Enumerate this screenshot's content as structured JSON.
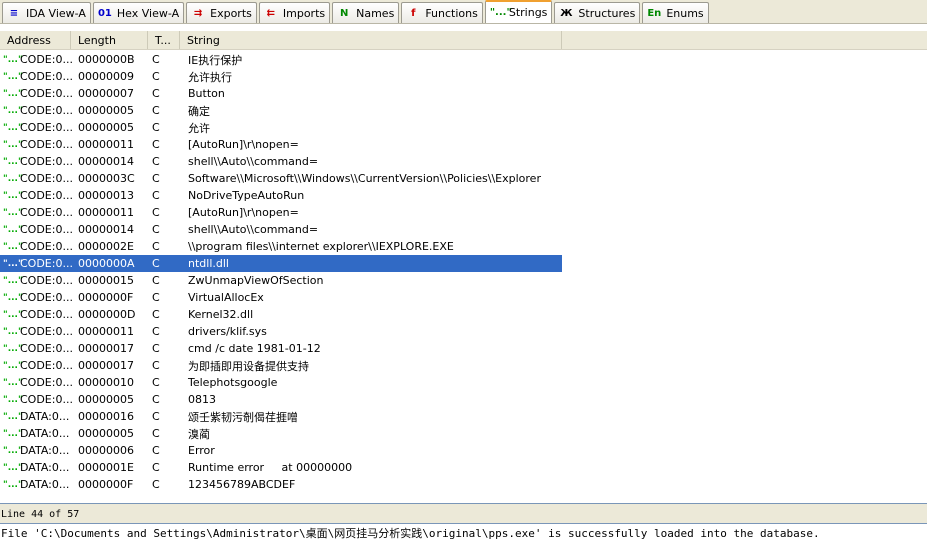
{
  "tabs": [
    {
      "label": "IDA View-A",
      "icon": "disassembly-icon",
      "glyph": "≡",
      "color": "#00c"
    },
    {
      "label": "Hex View-A",
      "icon": "hex-icon",
      "glyph": "01",
      "color": "#00c"
    },
    {
      "label": "Exports",
      "icon": "exports-icon",
      "glyph": "⇉",
      "color": "#c00"
    },
    {
      "label": "Imports",
      "icon": "imports-icon",
      "glyph": "⇇",
      "color": "#c00"
    },
    {
      "label": "Names",
      "icon": "names-icon",
      "glyph": "N",
      "color": "#080"
    },
    {
      "label": "Functions",
      "icon": "functions-icon",
      "glyph": "f",
      "color": "#c00"
    },
    {
      "label": "Strings",
      "icon": "strings-icon",
      "glyph": "\"...\"",
      "color": "#080"
    },
    {
      "label": "Structures",
      "icon": "structures-icon",
      "glyph": "Ж",
      "color": "#000"
    },
    {
      "label": "Enums",
      "icon": "enums-icon",
      "glyph": "En",
      "color": "#080"
    }
  ],
  "active_tab": "Strings",
  "columns": [
    "Address",
    "Length",
    "T...",
    "String"
  ],
  "row_marker": "\"...\"",
  "rows": [
    [
      "CODE:0...",
      "0000000B",
      "C",
      "IE执行保护"
    ],
    [
      "CODE:0...",
      "00000009",
      "C",
      "允许执行"
    ],
    [
      "CODE:0...",
      "00000007",
      "C",
      "Button"
    ],
    [
      "CODE:0...",
      "00000005",
      "C",
      "确定"
    ],
    [
      "CODE:0...",
      "00000005",
      "C",
      "允许"
    ],
    [
      "CODE:0...",
      "00000011",
      "C",
      "[AutoRun]\\r\\nopen="
    ],
    [
      "CODE:0...",
      "00000014",
      "C",
      "shell\\\\Auto\\\\command="
    ],
    [
      "CODE:0...",
      "0000003C",
      "C",
      "Software\\\\Microsoft\\\\Windows\\\\CurrentVersion\\\\Policies\\\\Explorer"
    ],
    [
      "CODE:0...",
      "00000013",
      "C",
      "NoDriveTypeAutoRun"
    ],
    [
      "CODE:0...",
      "00000011",
      "C",
      "[AutoRun]\\r\\nopen="
    ],
    [
      "CODE:0...",
      "00000014",
      "C",
      "shell\\\\Auto\\\\command="
    ],
    [
      "CODE:0...",
      "0000002E",
      "C",
      "\\\\program files\\\\internet explorer\\\\IEXPLORE.EXE"
    ],
    [
      "CODE:0...",
      "0000000A",
      "C",
      "ntdll.dll"
    ],
    [
      "CODE:0...",
      "00000015",
      "C",
      "ZwUnmapViewOfSection"
    ],
    [
      "CODE:0...",
      "0000000F",
      "C",
      "VirtualAllocEx"
    ],
    [
      "CODE:0...",
      "0000000D",
      "C",
      "Kernel32.dll"
    ],
    [
      "CODE:0...",
      "00000011",
      "C",
      "drivers/klif.sys"
    ],
    [
      "CODE:0...",
      "00000017",
      "C",
      "cmd /c date 1981-01-12"
    ],
    [
      "CODE:0...",
      "00000017",
      "C",
      "为即插即用设备提供支持"
    ],
    [
      "CODE:0...",
      "00000010",
      "C",
      "Telephotsgoogle"
    ],
    [
      "CODE:0...",
      "00000005",
      "C",
      "0813"
    ],
    [
      "DATA:0...",
      "00000016",
      "C",
      "颂壬紫韧污剞偈荏捱噌"
    ],
    [
      "DATA:0...",
      "00000005",
      "C",
      "溴蔺"
    ],
    [
      "DATA:0...",
      "00000006",
      "C",
      "Error"
    ],
    [
      "DATA:0...",
      "0000001E",
      "C",
      "Runtime error     at 00000000"
    ],
    [
      "DATA:0...",
      "0000000F",
      "C",
      "123456789ABCDEF"
    ]
  ],
  "selected_row": 12,
  "status": "Line 44 of 57",
  "message": "File 'C:\\Documents and Settings\\Administrator\\桌面\\网页挂马分析实践\\original\\pps.exe' is successfully loaded into the database."
}
